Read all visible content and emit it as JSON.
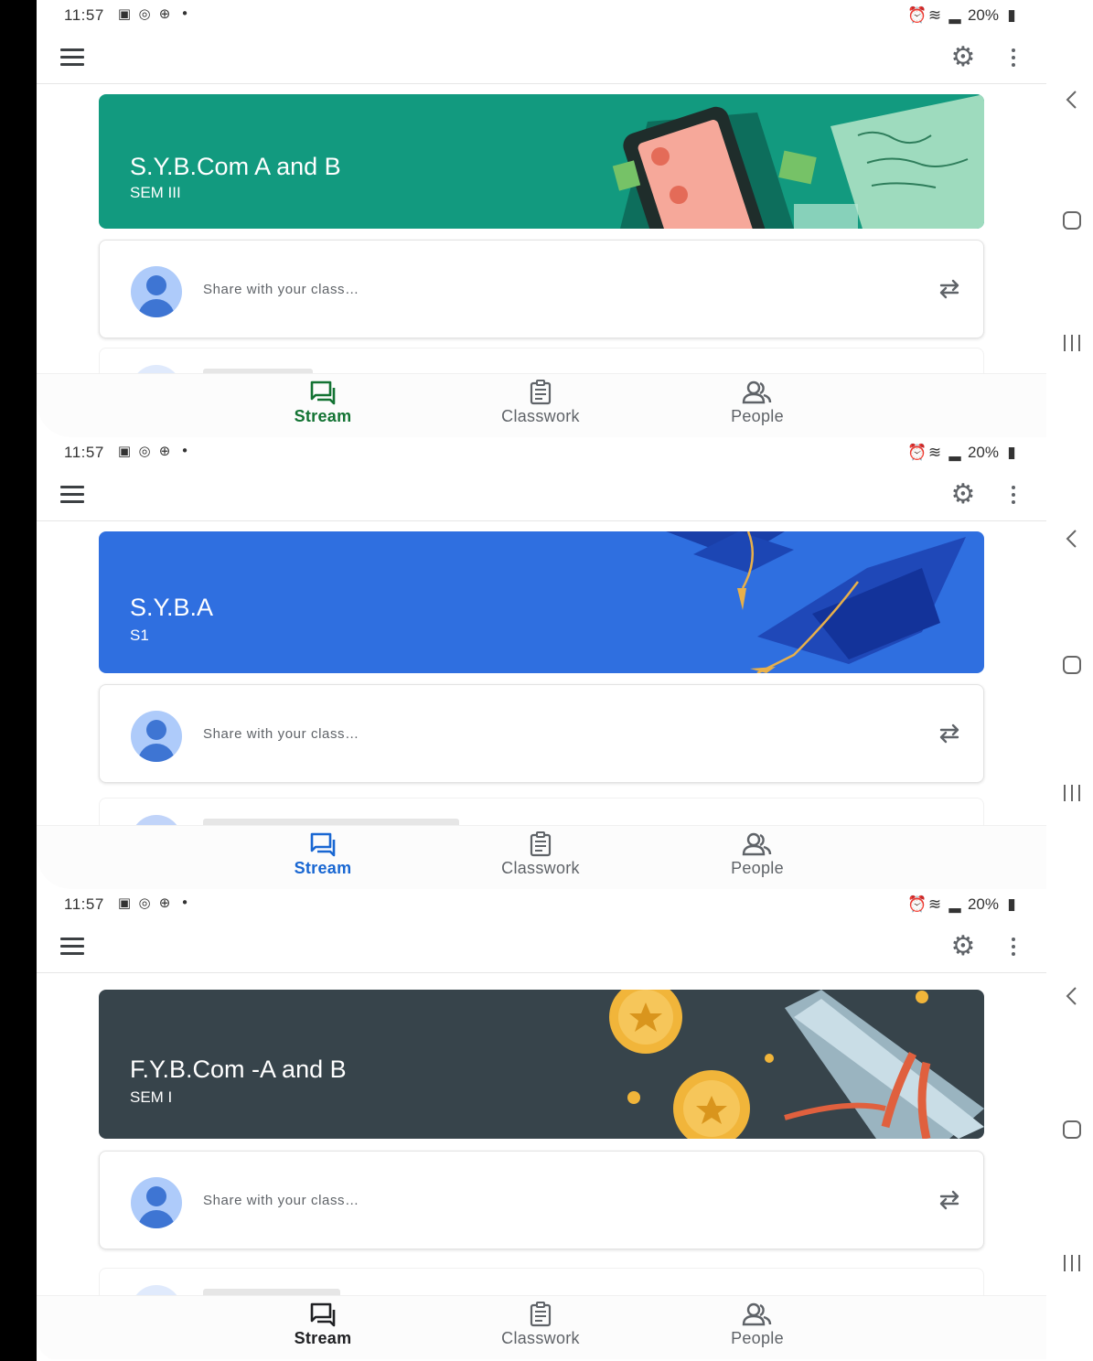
{
  "status_bar": {
    "time": "11:57",
    "battery": "20%"
  },
  "nav": {
    "stream": "Stream",
    "classwork": "Classwork",
    "people": "People"
  },
  "share_placeholder": "Share with your class…",
  "screens": [
    {
      "class_name": "S.Y.B.Com A and B",
      "section": "SEM III",
      "banner_color": "#129a7f",
      "active_tab_color": "#137333"
    },
    {
      "class_name": "S.Y.B.A",
      "section": "S1",
      "banner_color": "#2f6fe0",
      "active_tab_color": "#1967d2"
    },
    {
      "class_name": "F.Y.B.Com -A and B",
      "section": "SEM I",
      "banner_color": "#37444b",
      "active_tab_color": "#202124"
    }
  ],
  "icons": {
    "menu": "hamburger-icon",
    "settings": "gear-icon",
    "more": "more-vert-icon",
    "repost": "repost-icon",
    "stream": "stream-icon",
    "classwork": "classwork-icon",
    "people": "people-icon",
    "system_back": "chevron-left-icon",
    "system_home": "home-square-icon",
    "system_recents": "recents-icon"
  }
}
